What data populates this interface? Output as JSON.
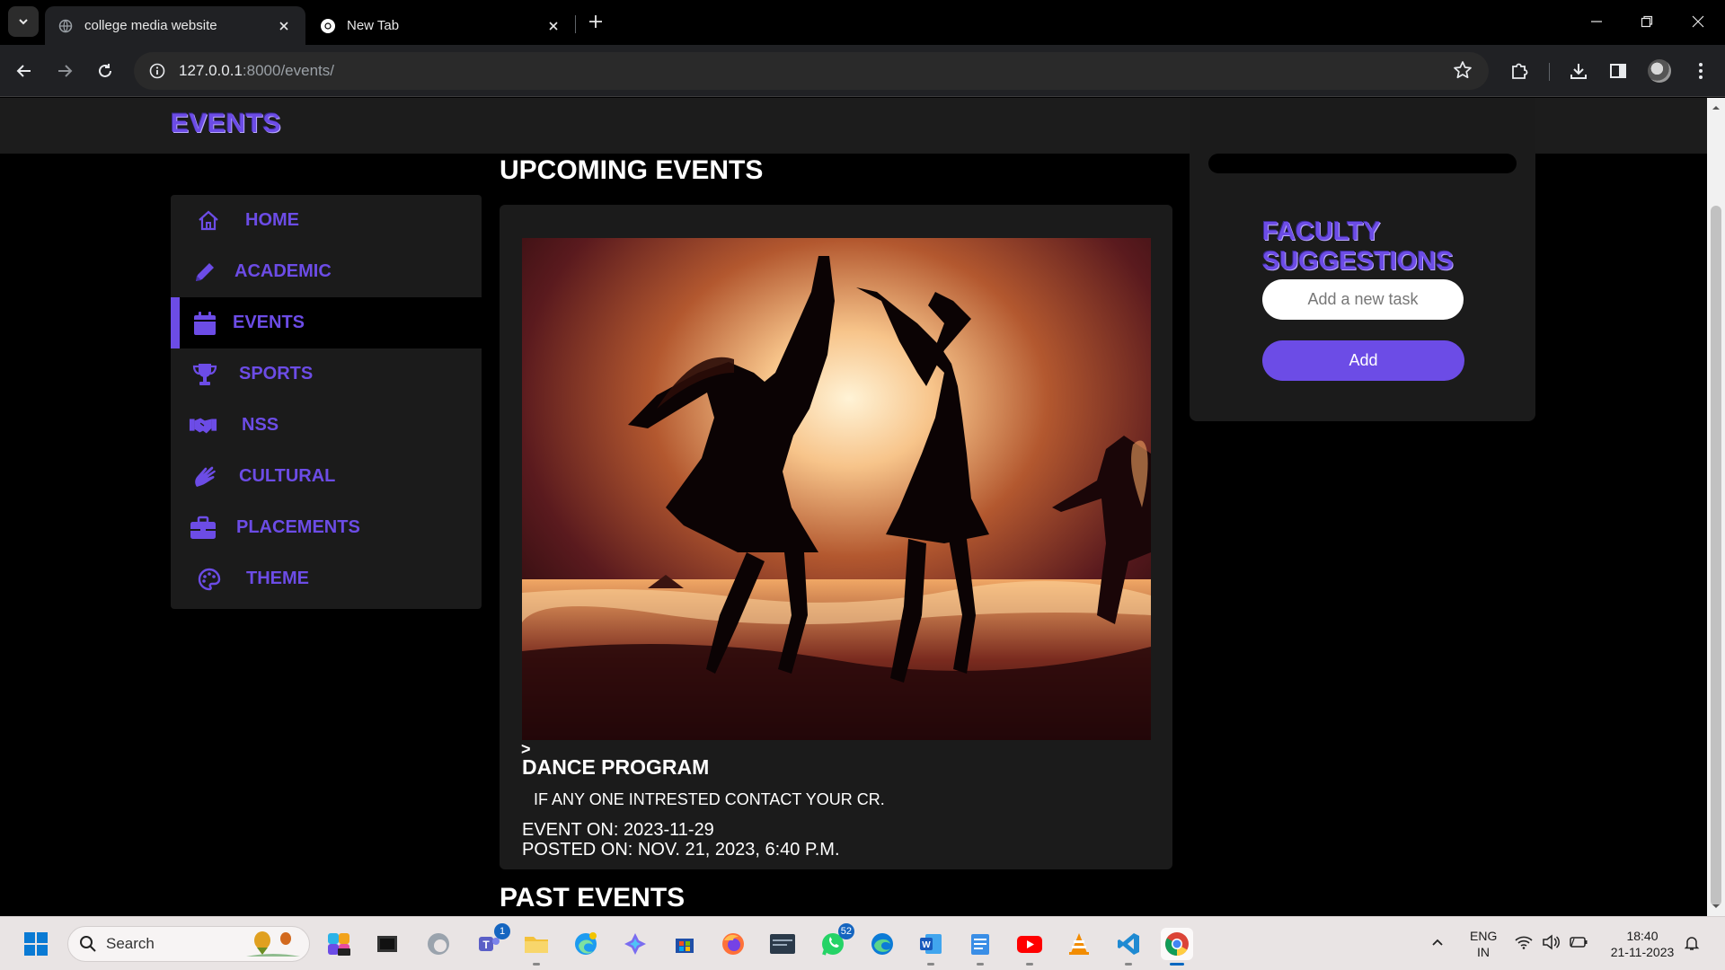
{
  "browser": {
    "tabs": [
      {
        "title": "college media website",
        "active": true
      },
      {
        "title": "New Tab",
        "active": false
      }
    ],
    "url": {
      "host": "127.0.0.1",
      "rest": ":8000/events/"
    }
  },
  "site": {
    "header_title": "EVENTS",
    "nav": [
      {
        "label": "HOME",
        "icon": "home-icon"
      },
      {
        "label": "ACADEMIC",
        "icon": "pencil-icon"
      },
      {
        "label": "EVENTS",
        "icon": "calendar-icon",
        "active": true
      },
      {
        "label": "SPORTS",
        "icon": "trophy-icon"
      },
      {
        "label": "NSS",
        "icon": "handshake-icon"
      },
      {
        "label": "CULTURAL",
        "icon": "hands-icon"
      },
      {
        "label": "PLACEMENTS",
        "icon": "briefcase-icon"
      },
      {
        "label": "THEME",
        "icon": "palette-icon"
      }
    ],
    "upcoming_title": "UPCOMING EVENTS",
    "past_title": "PAST EVENTS",
    "event": {
      "arrow": ">",
      "title": "DANCE PROGRAM",
      "description": "IF ANY ONE INTRESTED CONTACT YOUR CR.",
      "event_on": "EVENT ON: 2023-11-29",
      "posted_on": "POSTED ON: NOV. 21, 2023, 6:40 P.M."
    },
    "suggestions": {
      "title_line1": "FACULTY",
      "title_line2": "SUGGESTIONS",
      "input_placeholder": "Add a new task",
      "add_label": "Add"
    }
  },
  "taskbar": {
    "search_label": "Search",
    "teams_badge": "1",
    "whatsapp_badge": "52",
    "lang_line1": "ENG",
    "lang_line2": "IN",
    "time": "18:40",
    "date": "21-11-2023"
  },
  "colors": {
    "accent": "#6c4ce6",
    "page_bg": "#000000",
    "panel_bg": "#1b1b1b"
  }
}
